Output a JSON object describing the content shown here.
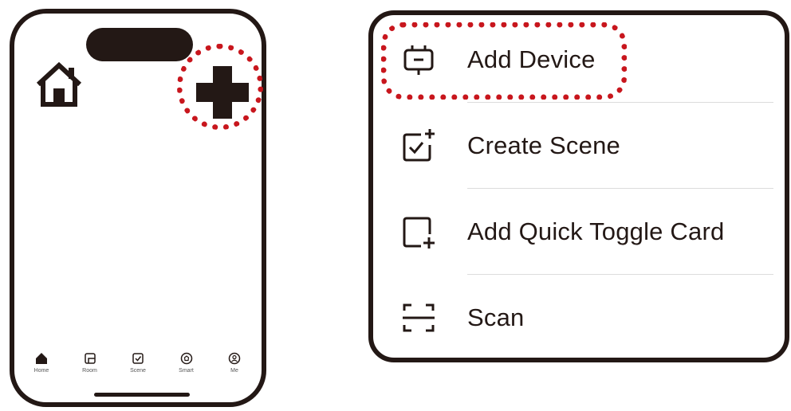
{
  "phone": {
    "icons": {
      "home": "house-icon",
      "add": "plus-icon"
    },
    "tabs": [
      {
        "label": "Home",
        "icon": "home-filled-icon"
      },
      {
        "label": "Room",
        "icon": "room-icon"
      },
      {
        "label": "Scene",
        "icon": "scene-check-icon"
      },
      {
        "label": "Smart",
        "icon": "smart-icon"
      },
      {
        "label": "Me",
        "icon": "profile-icon"
      }
    ]
  },
  "menu": {
    "items": [
      {
        "label": "Add Device",
        "icon": "device-icon"
      },
      {
        "label": "Create Scene",
        "icon": "create-scene-icon"
      },
      {
        "label": "Add Quick Toggle Card",
        "icon": "quick-toggle-card-icon"
      },
      {
        "label": "Scan",
        "icon": "scan-icon"
      }
    ]
  },
  "colors": {
    "outline": "#231815",
    "highlight": "#c8161d",
    "divider": "#dcdcdc"
  }
}
